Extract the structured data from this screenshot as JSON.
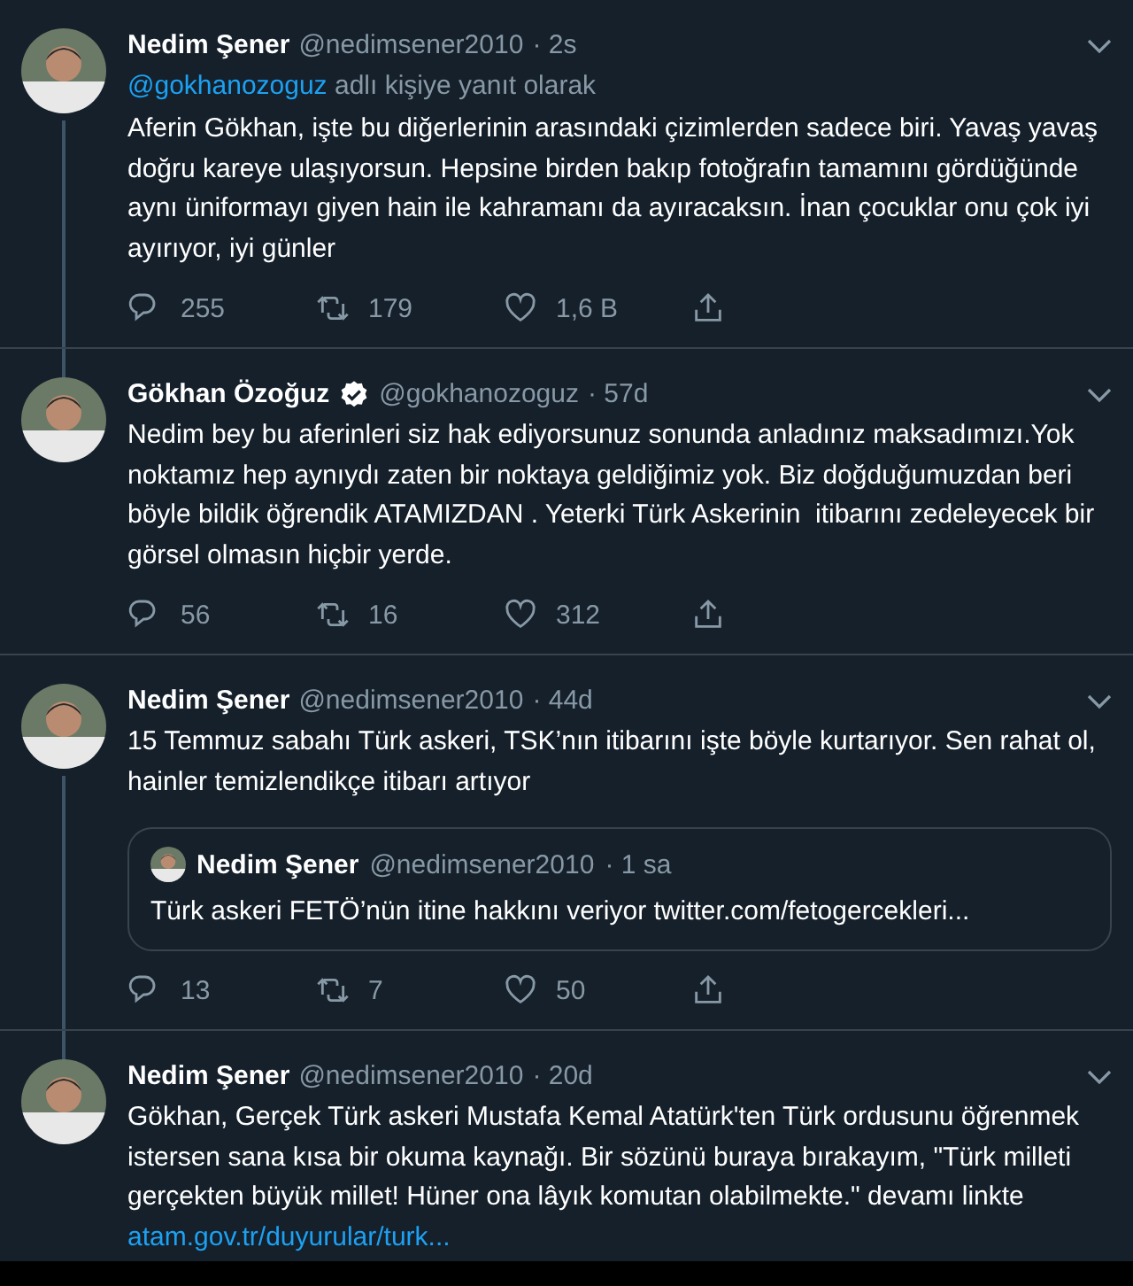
{
  "tweets": [
    {
      "name": "Nedim Şener",
      "verified": false,
      "handle": "@nedimsener2010",
      "time": "· 2s",
      "connected_to_previous": false,
      "connected_to_next": true,
      "reply_to": {
        "handle": "@gokhanozoguz",
        "text": "adlı kişiye yanıt olarak"
      },
      "body": "Aferin Gökhan, işte bu diğerlerinin arasındaki çizimlerden sadece biri. Yavaş yavaş doğru kareye ulaşıyorsun. Hepsine birden bakıp fotoğrafın tamamını gördüğünde aynı üniformayı giyen hain ile kahramanı da ayıracaksın. İnan çocuklar onu çok iyi ayırıyor, iyi günler",
      "stats": {
        "replies": "255",
        "retweets": "179",
        "likes": "1,6 B"
      }
    },
    {
      "name": "Gökhan Özoğuz",
      "verified": true,
      "handle": "@gokhanozoguz",
      "time": "· 57d",
      "connected_to_previous": true,
      "connected_to_next": false,
      "body": "Nedim bey bu aferinleri siz hak ediyorsunuz sonunda anladınız maksadımızı.Yok noktamız hep aynıydı zaten bir noktaya geldiğimiz yok. Biz doğduğumuzdan beri böyle bildik öğrendik ATAMIZDAN . Yeterki Türk Askerinin  itibarını zedeleyecek bir görsel olmasın hiçbir yerde.",
      "stats": {
        "replies": "56",
        "retweets": "16",
        "likes": "312"
      }
    },
    {
      "name": "Nedim Şener",
      "verified": false,
      "handle": "@nedimsener2010",
      "time": "· 44d",
      "connected_to_previous": false,
      "connected_to_next": true,
      "body": "15 Temmuz sabahı Türk askeri, TSK’nın itibarını işte böyle kurtarıyor. Sen rahat ol, hainler temizlendikçe itibarı artıyor",
      "quote": {
        "name": "Nedim Şener",
        "handle": "@nedimsener2010",
        "time": "· 1 sa",
        "body": "Türk askeri FETÖ’nün itine hakkını veriyor twitter.com/fetogercekleri..."
      },
      "stats": {
        "replies": "13",
        "retweets": "7",
        "likes": "50"
      }
    },
    {
      "name": "Nedim Şener",
      "verified": false,
      "handle": "@nedimsener2010",
      "time": "· 20d",
      "connected_to_previous": true,
      "connected_to_next": false,
      "body": "Gökhan, Gerçek Türk askeri Mustafa Kemal Atatürk'ten Türk ordusunu öğrenmek istersen sana kısa bir okuma kaynağı. Bir sözünü buraya bırakayım, \"Türk milleti gerçekten büyük millet! Hüner ona lâyık komutan olabilmekte.\" devamı linkte",
      "link": "atam.gov.tr/duyurular/turk..."
    }
  ]
}
